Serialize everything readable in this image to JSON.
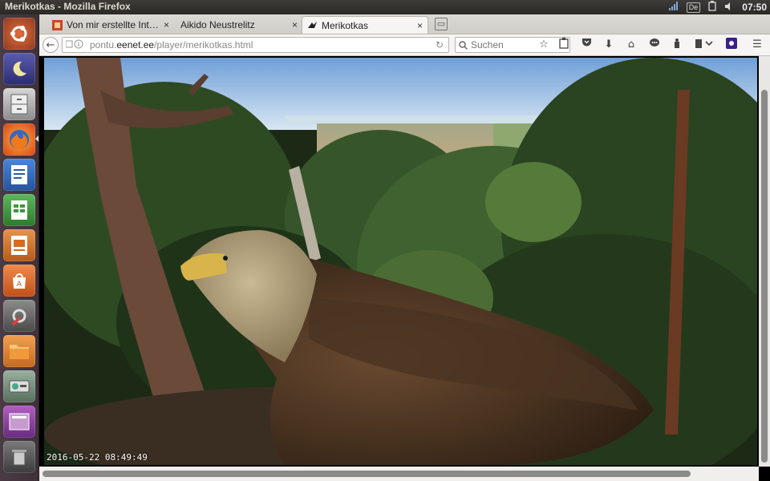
{
  "window": {
    "title": "Merikotkas - Mozilla Firefox"
  },
  "tray": {
    "keyboard": "De",
    "clock": "07:50"
  },
  "tabs": [
    {
      "label": "Von mir erstellte Int…"
    },
    {
      "label": "Aikido Neustrelitz"
    },
    {
      "label": "Merikotkas"
    }
  ],
  "url": {
    "host_prefix": "pontu.",
    "host_main": "eenet.ee",
    "path": "/player/merikotkas.html"
  },
  "search": {
    "placeholder": "Suchen"
  },
  "video": {
    "timestamp": "2016-05-22 08:49:49"
  },
  "launcher": {
    "apps": [
      "ubuntu-dash",
      "desktop-switcher",
      "file-cabinet",
      "firefox",
      "writer",
      "calc",
      "impress",
      "software-center",
      "system-settings",
      "files",
      "disk-usage",
      "workspace-switcher",
      "trash"
    ]
  },
  "colors": {
    "accent": "#e95420",
    "tab_active": "#f6f5f4"
  }
}
